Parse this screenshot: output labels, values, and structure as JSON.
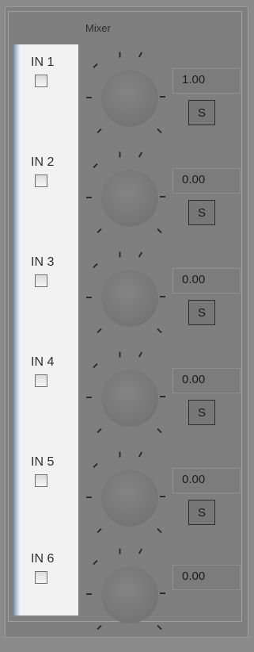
{
  "mixer": {
    "title": "Mixer",
    "channels": [
      {
        "label": "IN 1",
        "value": "1.00",
        "solo_label": "S",
        "checked": false
      },
      {
        "label": "IN 2",
        "value": "0.00",
        "solo_label": "S",
        "checked": false
      },
      {
        "label": "IN 3",
        "value": "0.00",
        "solo_label": "S",
        "checked": false
      },
      {
        "label": "IN 4",
        "value": "0.00",
        "solo_label": "S",
        "checked": false
      },
      {
        "label": "IN 5",
        "value": "0.00",
        "solo_label": "S",
        "checked": false
      },
      {
        "label": "IN 6",
        "value": "0.00",
        "solo_label": null,
        "checked": false
      }
    ]
  },
  "colors": {
    "background": "#8a8a8a",
    "panel": "#7f7f7f",
    "left_strip": "#f2f2f2",
    "accent_strip": "#b9c9dd"
  }
}
